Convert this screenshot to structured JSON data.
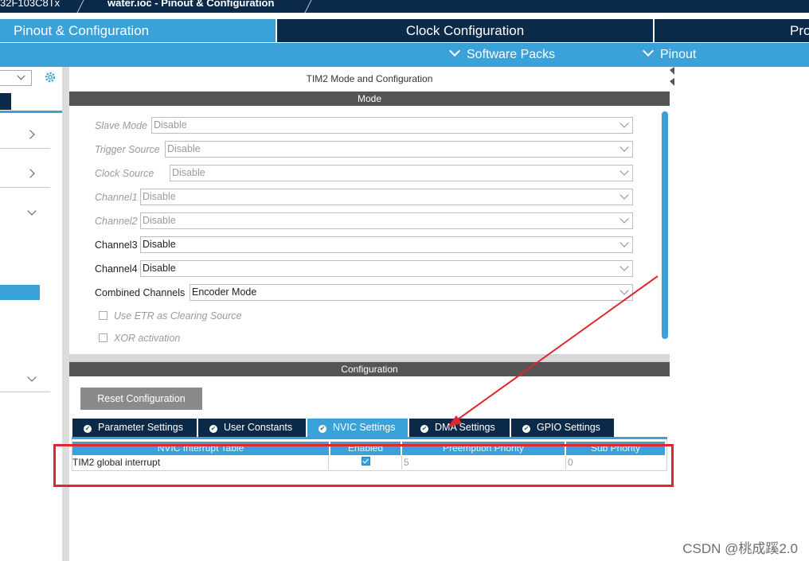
{
  "breadcrumb": {
    "device": "32F103C8Tx",
    "file": "water.ioc - Pinout & Configuration"
  },
  "tabs": [
    {
      "label": "Pinout & Configuration",
      "active": true
    },
    {
      "label": "Clock Configuration",
      "active": false
    },
    {
      "label": "Pro",
      "active": false
    }
  ],
  "subbar": {
    "software_packs": "Software Packs",
    "pinout": "Pinout"
  },
  "panel": {
    "title": "TIM2 Mode and Configuration",
    "mode_header": "Mode",
    "config_header": "Configuration"
  },
  "mode_fields": [
    {
      "label": "Slave Mode",
      "value": "Disable",
      "enabled": false
    },
    {
      "label": "Trigger Source",
      "value": "Disable",
      "enabled": false
    },
    {
      "label": "Clock Source",
      "value": "Disable",
      "enabled": false
    },
    {
      "label": "Channel1",
      "value": "Disable",
      "enabled": false
    },
    {
      "label": "Channel2",
      "value": "Disable",
      "enabled": false
    },
    {
      "label": "Channel3",
      "value": "Disable",
      "enabled": true
    },
    {
      "label": "Channel4",
      "value": "Disable",
      "enabled": true
    },
    {
      "label": "Combined Channels",
      "value": "Encoder Mode",
      "enabled": true
    }
  ],
  "checkboxes": [
    {
      "label": "Use ETR as Clearing Source",
      "checked": false
    },
    {
      "label": "XOR activation",
      "checked": false
    }
  ],
  "reset_button": "Reset Configuration",
  "config_tabs": [
    {
      "label": "Parameter Settings",
      "active": false
    },
    {
      "label": "User Constants",
      "active": false
    },
    {
      "label": "NVIC Settings",
      "active": true
    },
    {
      "label": "DMA Settings",
      "active": false
    },
    {
      "label": "GPIO Settings",
      "active": false
    }
  ],
  "nvic_table": {
    "headers": [
      "NVIC Interrupt Table",
      "Enabled",
      "Preemption Priority",
      "Sub Priority"
    ],
    "rows": [
      {
        "name": "TIM2 global interrupt",
        "enabled": true,
        "preemption": "5",
        "sub": "0"
      }
    ]
  },
  "watermark": "CSDN @桃成蹊2.0",
  "colors": {
    "navy": "#0b2a4a",
    "accent": "#3ba1d9",
    "annotation_red": "#e0262e"
  }
}
